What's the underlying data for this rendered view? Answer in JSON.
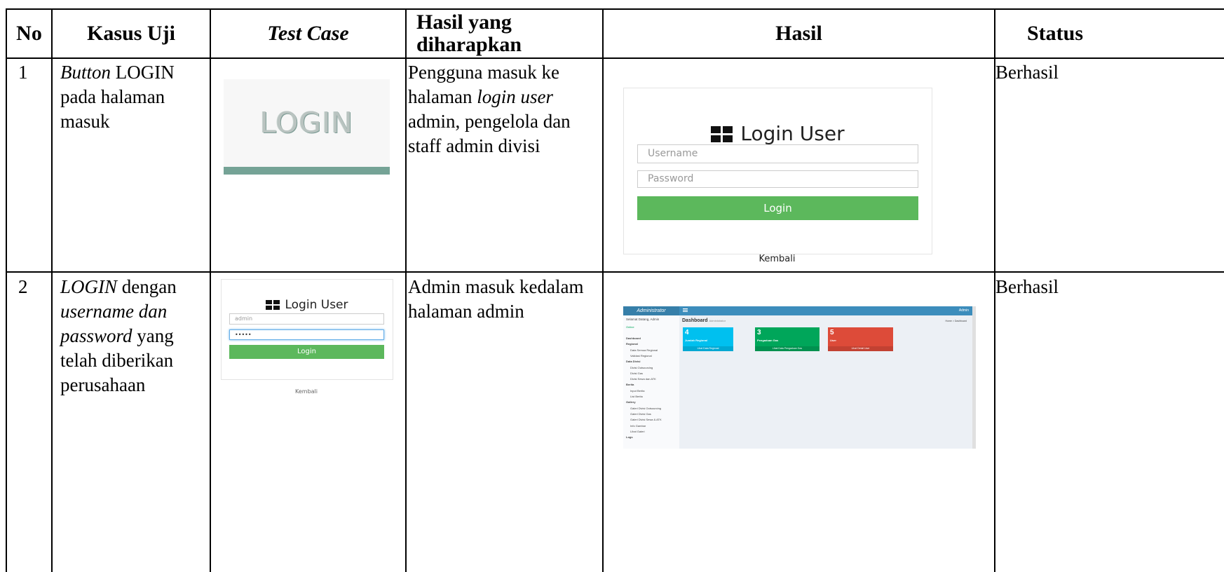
{
  "table": {
    "headers": {
      "no": "No",
      "kasus_uji": "Kasus Uji",
      "test_case": "Test Case",
      "hasil_diharapkan": "Hasil yang diharapkan",
      "hasil": "Hasil",
      "status": "Status"
    },
    "rows": [
      {
        "no": "1",
        "kasus_uji": {
          "italic": "Button",
          "rest": " LOGIN pada halaman masuk"
        },
        "expected": {
          "a": "Pengguna masuk ke halaman ",
          "italic": "login user",
          "b": " admin, pengelola dan staff admin divisi"
        },
        "status": "Berhasil"
      },
      {
        "no": "2",
        "kasus_uji": {
          "italic1": "LOGIN",
          "a": " dengan ",
          "italic2": "username dan password",
          "b": " yang telah diberikan perusahaan"
        },
        "expected": "Admin masuk kedalam halaman admin",
        "status": "Berhasil"
      }
    ]
  },
  "shots": {
    "login_button": {
      "label": "LOGIN"
    },
    "login_form": {
      "title": "Login User",
      "username_placeholder": "Username",
      "password_placeholder": "Password",
      "button": "Login",
      "back": "Kembali"
    },
    "login_filled": {
      "title": "Login User",
      "username_value": "admin",
      "password_value": "•••••",
      "button": "Login",
      "back": "Kembali"
    },
    "dashboard": {
      "brand": "Administrator",
      "user": "Admin",
      "page_title": "Dashboard",
      "page_subtitle": "Administrator",
      "breadcrumb": "Home > Dashboard",
      "profile": "Selamat Datang, Admin",
      "online": "Online",
      "menu": [
        "Dashboard",
        "Regional",
        "Data Semua Regional",
        "Validasi Regional",
        "Data Divisi",
        "Divisi Outsourcing",
        "Divisi Gas",
        "Divisi Sewa dan ATK",
        "Berita",
        "Input Berita",
        "List Berita",
        "Gallery",
        "Galeri Divisi Outsourcing",
        "Galeri Divisi Gas",
        "Galeri Divisi Sewa & ATK",
        "Info Gambar",
        "Lihat Galeri",
        "Logs"
      ],
      "boxes": [
        {
          "value": "4",
          "label": "Jumlah Regional",
          "footer": "Lihat Data Regional",
          "color": "#00c0ef"
        },
        {
          "value": "3",
          "label": "Pengaduan Gas",
          "footer": "Lihat Data Pengaduan Gas",
          "color": "#00a65a"
        },
        {
          "value": "5",
          "label": "User",
          "footer": "Lihat Detail User",
          "color": "#dd4b39"
        }
      ]
    }
  }
}
